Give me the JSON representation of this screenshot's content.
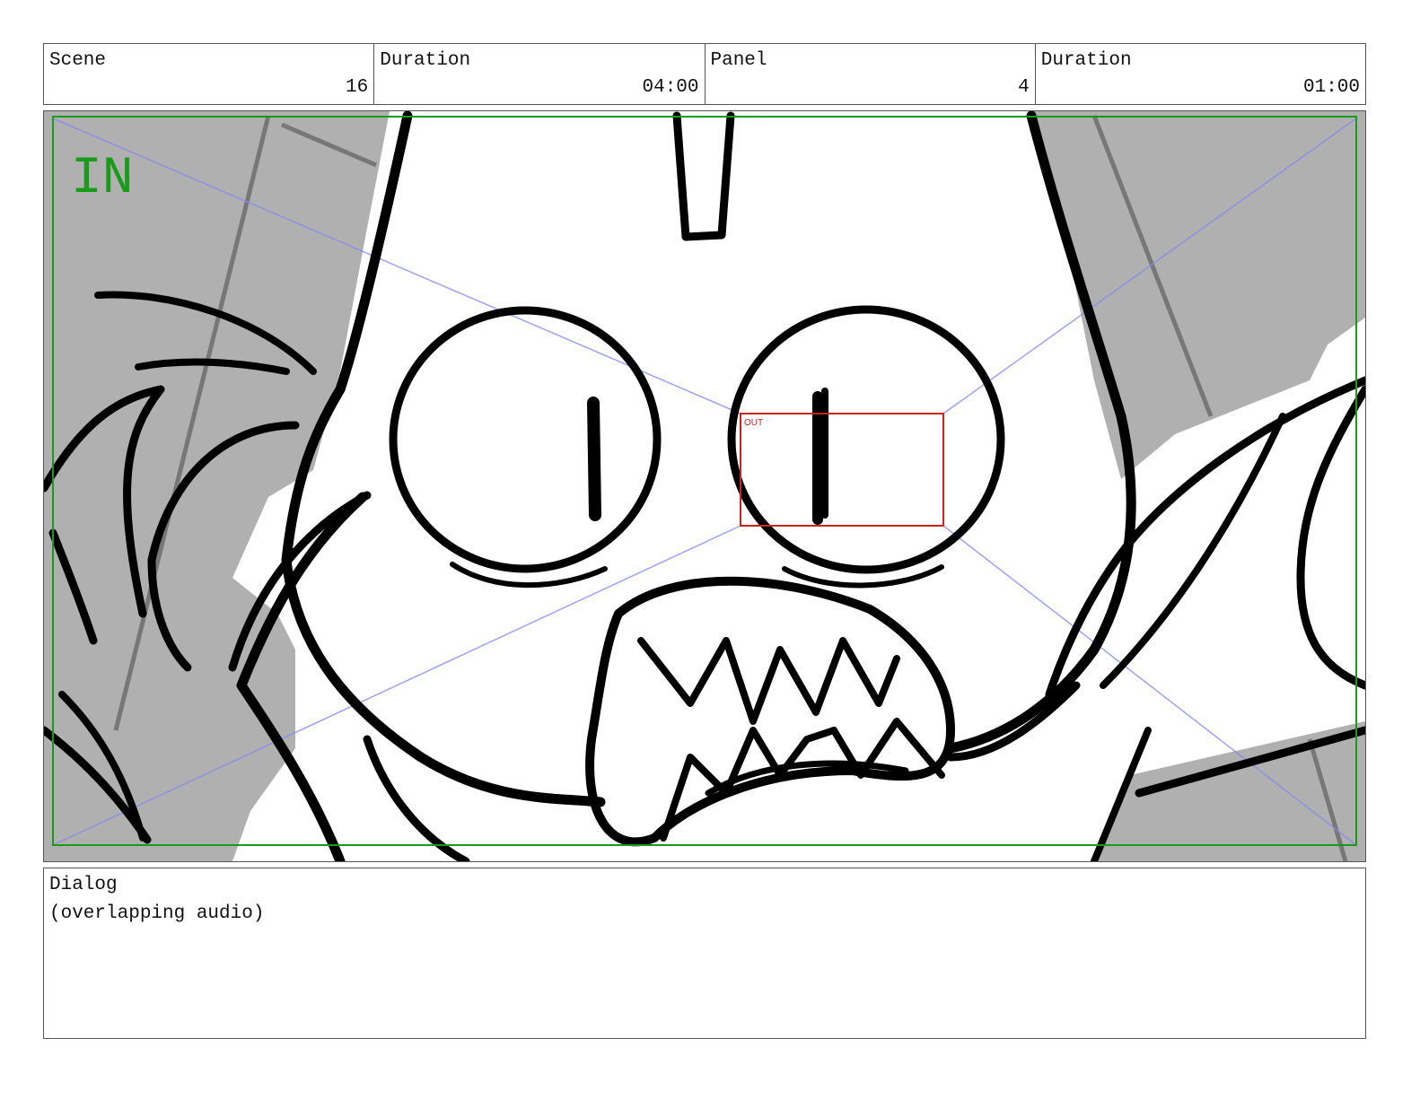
{
  "header": {
    "scene_label": "Scene",
    "scene_value": "16",
    "scene_duration_label": "Duration",
    "scene_duration_value": "04:00",
    "panel_label": "Panel",
    "panel_value": "4",
    "panel_duration_label": "Duration",
    "panel_duration_value": "01:00"
  },
  "frame": {
    "in_label": "IN",
    "out_label": "OUT",
    "in_color": "#1a9a1a",
    "out_color": "#cc2222",
    "guide_color": "#8888ee"
  },
  "dialog": {
    "label": "Dialog",
    "text": "(overlapping audio)"
  }
}
